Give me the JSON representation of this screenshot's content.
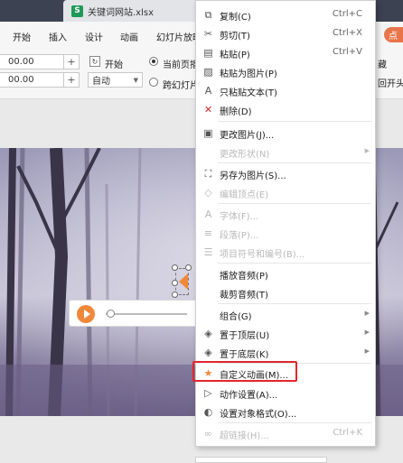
{
  "window": {
    "tab_label": "关键词网站.xlsx",
    "tab_icon": "S"
  },
  "ribbon": {
    "menus": [
      "开始",
      "插入",
      "设计",
      "动画",
      "幻灯片放映"
    ],
    "right_label": "点"
  },
  "toolbar": {
    "spin1_value": "00.00",
    "spin2_value": "00.00",
    "start_label": "开始",
    "select_value": "自动",
    "radio_current": "当前页播",
    "radio_cross": "跨幻灯片",
    "right_text_1": "藏",
    "right_text_2": "回开头"
  },
  "context_menu": {
    "items": [
      {
        "icon": "copy-icon",
        "label": "复制(C)",
        "shortcut": "Ctrl+C",
        "disabled": false
      },
      {
        "icon": "cut-icon",
        "label": "剪切(T)",
        "shortcut": "Ctrl+X",
        "disabled": false
      },
      {
        "icon": "paste-icon",
        "label": "粘贴(P)",
        "shortcut": "Ctrl+V",
        "disabled": false
      },
      {
        "icon": "paste-picture-icon",
        "label": "粘贴为图片(P)",
        "shortcut": "",
        "disabled": false
      },
      {
        "icon": "paste-text-icon",
        "label": "只粘贴文本(T)",
        "shortcut": "",
        "disabled": false
      },
      {
        "icon": "delete-icon",
        "label": "删除(D)",
        "shortcut": "",
        "disabled": false
      },
      {
        "icon": "change-picture-icon",
        "label": "更改图片(J)...",
        "shortcut": "",
        "disabled": false
      },
      {
        "icon": "change-shape-icon",
        "label": "更改形状(N)",
        "shortcut": "",
        "disabled": true
      },
      {
        "icon": "save-picture-icon",
        "label": "另存为图片(S)...",
        "shortcut": "",
        "disabled": false
      },
      {
        "icon": "edit-points-icon",
        "label": "编辑顶点(E)",
        "shortcut": "",
        "disabled": true
      },
      {
        "icon": "font-icon",
        "label": "字体(F)...",
        "shortcut": "",
        "disabled": true
      },
      {
        "icon": "paragraph-icon",
        "label": "段落(P)...",
        "shortcut": "",
        "disabled": true
      },
      {
        "icon": "bullets-icon",
        "label": "项目符号和编号(B)...",
        "shortcut": "",
        "disabled": true
      },
      {
        "icon": "",
        "label": "播放音频(P)",
        "shortcut": "",
        "disabled": false
      },
      {
        "icon": "",
        "label": "裁剪音频(T)",
        "shortcut": "",
        "disabled": false
      },
      {
        "icon": "",
        "label": "组合(G)",
        "shortcut": "",
        "disabled": false
      },
      {
        "icon": "bring-front-icon",
        "label": "置于顶层(U)",
        "shortcut": "",
        "disabled": false
      },
      {
        "icon": "send-back-icon",
        "label": "置于底层(K)",
        "shortcut": "",
        "disabled": false
      },
      {
        "icon": "custom-animation-icon",
        "label": "自定义动画(M)...",
        "shortcut": "",
        "disabled": false
      },
      {
        "icon": "action-settings-icon",
        "label": "动作设置(A)...",
        "shortcut": "",
        "disabled": false
      },
      {
        "icon": "format-object-icon",
        "label": "设置对象格式(O)...",
        "shortcut": "",
        "disabled": false
      },
      {
        "icon": "hyperlink-icon",
        "label": "超链接(H)...",
        "shortcut": "Ctrl+K",
        "disabled": true
      }
    ]
  },
  "colors": {
    "accent_orange": "#f0883a",
    "highlight_red": "#e3262b",
    "tab_bar": "#3d4252"
  }
}
